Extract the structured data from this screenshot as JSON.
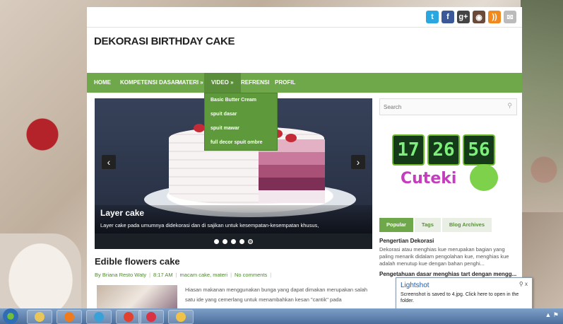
{
  "social_icons": [
    {
      "name": "twitter-icon",
      "glyph": "t",
      "color": "#2aa7e0"
    },
    {
      "name": "facebook-icon",
      "glyph": "f",
      "color": "#3b5998"
    },
    {
      "name": "google-plus-icon",
      "glyph": "g+",
      "color": "#444444"
    },
    {
      "name": "instagram-icon",
      "glyph": "◉",
      "color": "#6b4a3a"
    },
    {
      "name": "rss-icon",
      "glyph": "))",
      "color": "#f08a1e"
    },
    {
      "name": "email-icon",
      "glyph": "✉",
      "color": "#bbbbbb"
    }
  ],
  "site": {
    "title": "DEKORASI BIRTHDAY CAKE"
  },
  "nav": {
    "items": [
      "HOME",
      "KOMPETENSI DASAR",
      "MATERI »",
      "VIDEO »",
      "REFRENSI",
      "PROFIL"
    ],
    "dropdown": [
      "Basic Butter Cream",
      "spuit dasar",
      "spuit mawar",
      "full decor spuit ombre"
    ]
  },
  "slider": {
    "title": "Layer cake",
    "text": "Layer cake pada umumnya didekorasi dan di sajikan untuk kesempatan-kesempatan khusus,",
    "prev": "‹",
    "next": "›",
    "dot_count": 5,
    "active_dot": 5
  },
  "post": {
    "title": "Edible flowers cake",
    "meta": {
      "author": "By Briana Resto Waty",
      "time": "8:17 AM",
      "labels": "macam cake, materi",
      "comments": "No comments"
    },
    "body": "Hiasan makanan menggunakan bunga yang dapat dimakan merupakan salah satu ide yang cemerlang untuk menambahkan kesan \"cantik\" pada"
  },
  "sidebar": {
    "search_placeholder": "Search",
    "clock": {
      "h": "17",
      "m": "26",
      "s": "56",
      "brand": "Cuteki"
    },
    "tabs": [
      "Popular",
      "Tags",
      "Blog Archives"
    ],
    "popular_title": "Pengertian Dekorasi",
    "popular_text": "Dekorasi atau menghias kue merupakan bagian yang paling menarik didalam pengolahan kue, menghias kue adalah menutup kue dengan bahan penghi...",
    "popular_title2": "Pengetahuan dasar menghias tart dengan mengg..."
  },
  "notification": {
    "title": "Lightshot",
    "body": "Screenshot is saved to 4.jpg. Click here to open in the folder.",
    "pin": "⚲",
    "close": "x"
  },
  "taskbar": {
    "apps": [
      {
        "name": "explorer-icon",
        "color": "#e9c65a"
      },
      {
        "name": "media-player-icon",
        "color": "#f07a1e"
      },
      {
        "name": "pinned-app-icon",
        "color": "#3aa0d8"
      },
      {
        "name": "chrome-icon",
        "color": "#e2412f"
      },
      {
        "name": "lightshot-icon",
        "color": "#d93344"
      },
      {
        "name": "browser-window-icon",
        "color": "#f0c24a"
      }
    ]
  }
}
